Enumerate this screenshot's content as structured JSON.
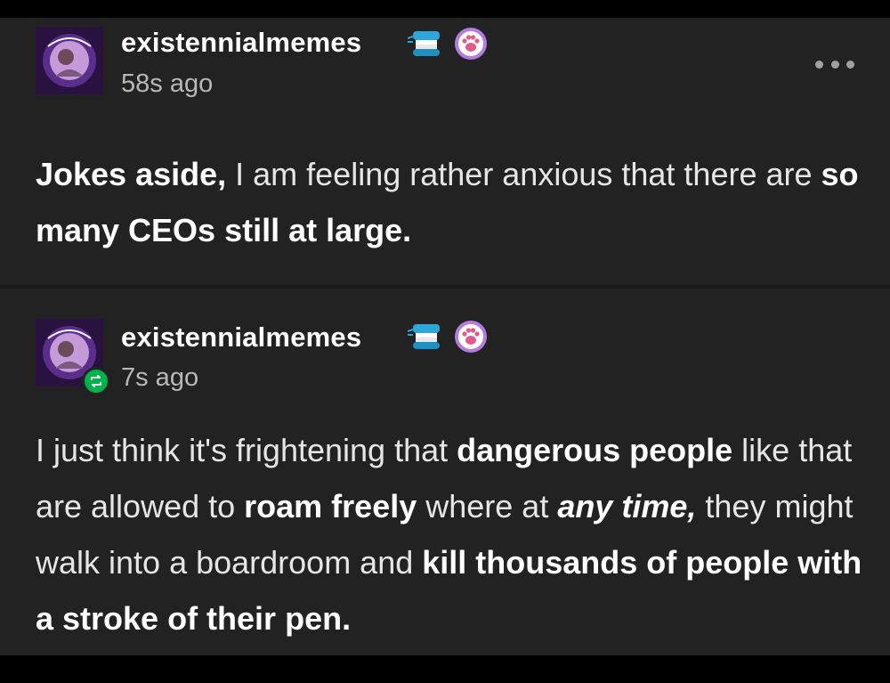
{
  "posts": [
    {
      "username": "existennialmemes",
      "timestamp": "58s ago",
      "is_reblog": false,
      "body": [
        {
          "t": "Jokes aside,",
          "b": true
        },
        {
          "t": " I am feeling rather anxious that there are "
        },
        {
          "t": "so many CEOs still at large.",
          "b": true
        }
      ]
    },
    {
      "username": "existennialmemes",
      "timestamp": "7s ago",
      "is_reblog": true,
      "body": [
        {
          "t": "I just think it's frightening that "
        },
        {
          "t": "dangerous people",
          "b": true
        },
        {
          "t": " like that are allowed to "
        },
        {
          "t": "roam freely",
          "b": true
        },
        {
          "t": " where at "
        },
        {
          "t": "any time,",
          "b": true,
          "i": true
        },
        {
          "t": " they might walk into a boardroom and "
        },
        {
          "t": "kill thousands of people with a stroke of their pen.",
          "b": true
        }
      ]
    }
  ],
  "icons": {
    "more": "more-options-icon",
    "badge_1": "chattering-teeth-icon",
    "badge_2": "paw-badge-icon",
    "reblog": "reblog-icon"
  },
  "colors": {
    "background": "#000000",
    "card": "#222222",
    "username": "#ffffff",
    "timestamp": "#b8b8b8",
    "text": "#e6e6e6",
    "reblog_badge": "#00b34a",
    "paw_badge": "#b47be0"
  }
}
